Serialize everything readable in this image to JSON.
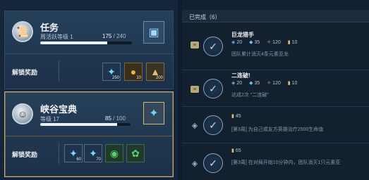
{
  "left": {
    "mission_panel": {
      "title": "任务",
      "subtitle": "周活跃等级 1",
      "progress_text": "175",
      "progress_max": "/ 240",
      "progress_fraction": 0.73,
      "unlock_label": "解锁奖励",
      "rewards": [
        {
          "icon": "crystal-icon",
          "count": "250"
        },
        {
          "icon": "coin-icon",
          "count": "10"
        },
        {
          "icon": "rank-up-icon",
          "count": "200"
        }
      ]
    },
    "valley_panel": {
      "title": "峡谷宝典",
      "subtitle": "等级 17",
      "progress_text": "85",
      "progress_max": "/ 100",
      "progress_fraction": 0.85,
      "unlock_label": "解锁奖励",
      "rewards": [
        {
          "icon": "crystal-icon",
          "count": "60"
        },
        {
          "icon": "crystal-icon",
          "count": "70"
        },
        {
          "icon": "green-token-icon",
          "count": ""
        },
        {
          "icon": "flower-icon",
          "count": ""
        }
      ]
    }
  },
  "right": {
    "header": "已完成（6）",
    "tasks": [
      {
        "name": "巨龙猎手",
        "rewards": [
          "20",
          "35",
          "120",
          "10"
        ],
        "desc": "团队累计消灭4条元素亚龙"
      },
      {
        "name": "二连破!",
        "rewards": [
          "20",
          "35",
          "120",
          "10"
        ],
        "desc": "达成2次 \"二连破\""
      },
      {
        "name": "",
        "rewards": [
          "45"
        ],
        "desc": "[第3周] 为自己或友方英雄治疗2500生命值"
      },
      {
        "name": "",
        "rewards": [
          "65"
        ],
        "desc": "[第3周] 在对局开始10分钟内，团队消灭1只元素亚"
      }
    ]
  },
  "colors": {
    "accent_gold": "#c9a96a",
    "bar_fill": "#e8f0f8",
    "background": "#101d2e"
  }
}
